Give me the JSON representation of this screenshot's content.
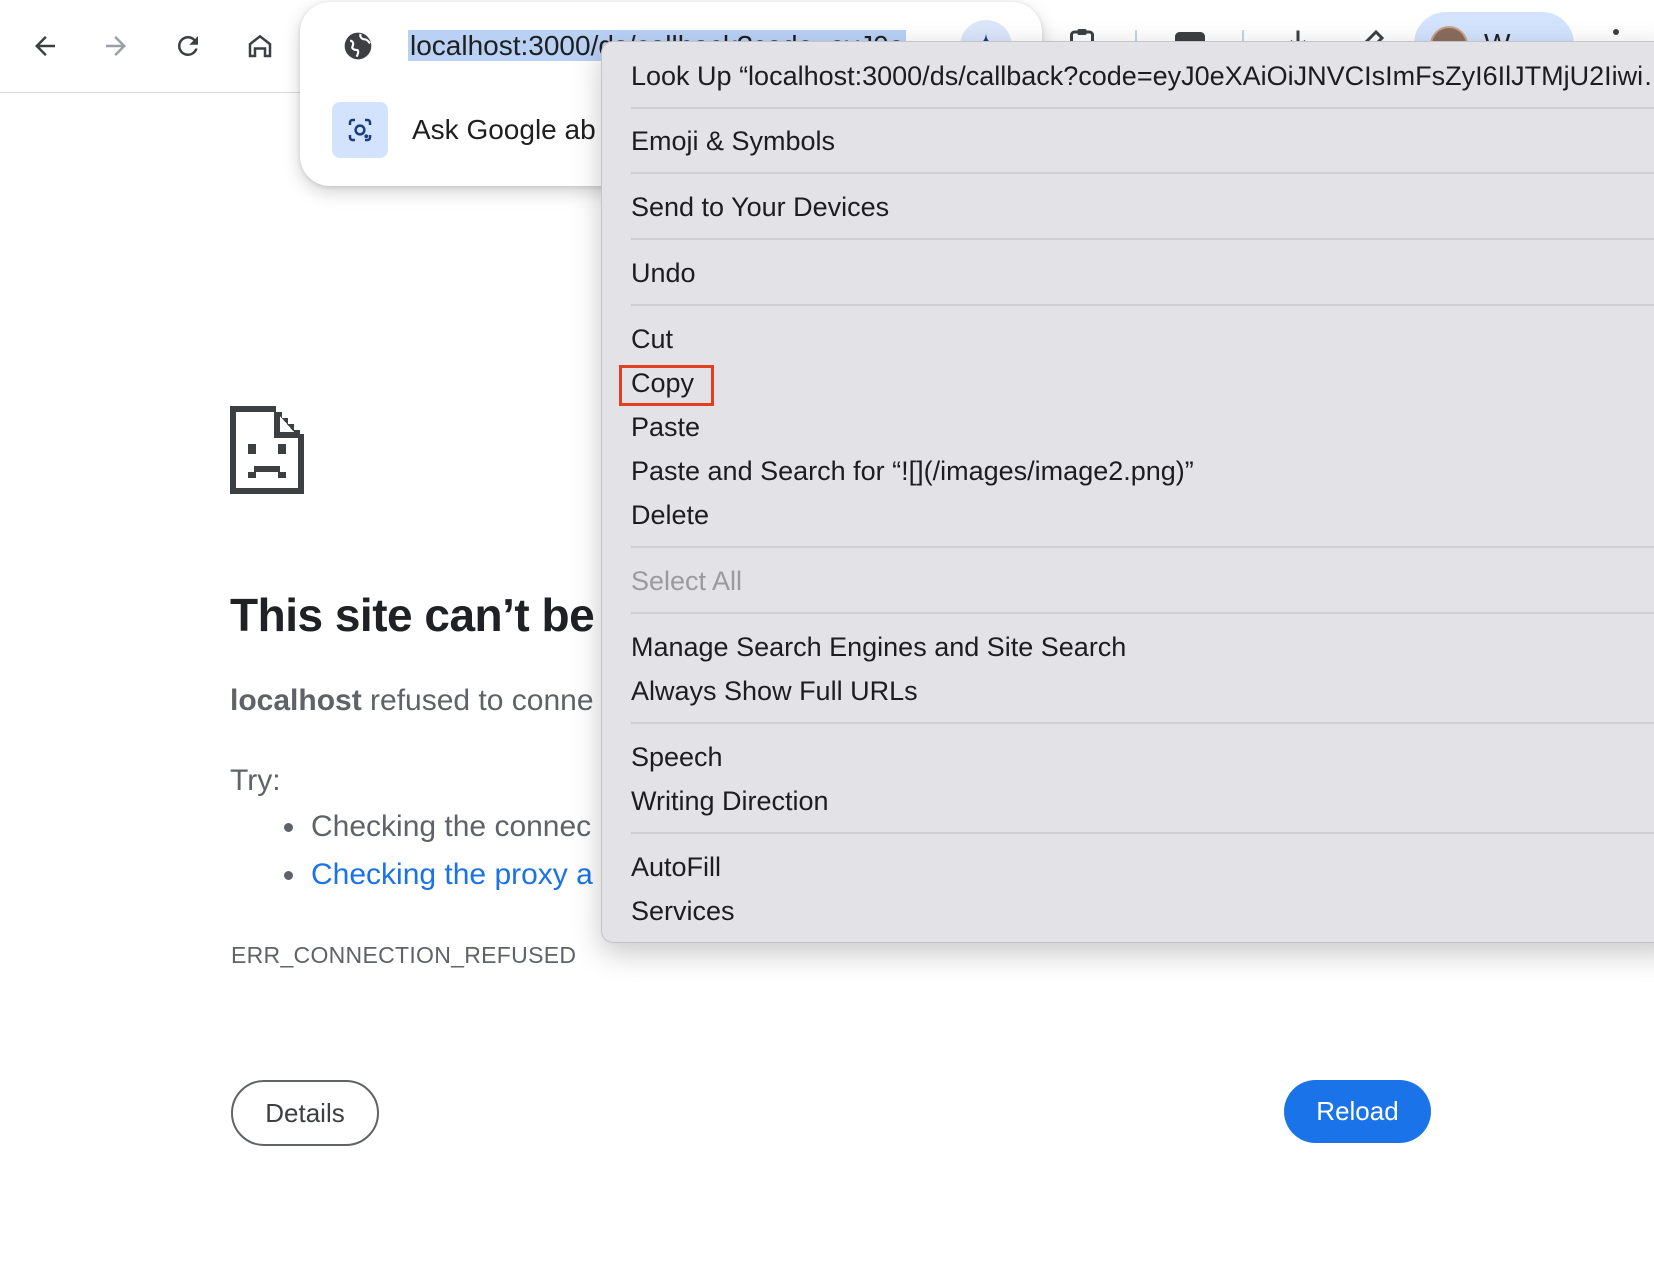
{
  "toolbar": {
    "back_icon": "arrow-left-icon",
    "forward_icon": "arrow-right-icon",
    "reload_icon": "reload-icon",
    "home_icon": "home-icon",
    "profile_name": "W...",
    "right_icons": [
      "clipboard-icon",
      "sidebar-icon",
      "download-icon",
      "pen-icon"
    ]
  },
  "omnibox": {
    "url": "localhost:3000/ds/callback?code=eyJ0e",
    "suggestion": "Ask Google ab",
    "site_icon": "globe-icon",
    "spark_icon": "sparkle-icon",
    "lens_icon": "google-lens-icon",
    "selection_color": "#b9d1f5"
  },
  "error_page": {
    "title": "This site can’t be r",
    "host": "localhost",
    "description_rest": " refused to conne",
    "try_label": "Try:",
    "suggestions": [
      "Checking the connec",
      "Checking the proxy a"
    ],
    "error_code": "ERR_CONNECTION_REFUSED",
    "details_label": "Details",
    "reload_label": "Reload",
    "link_color": "#1a73e8"
  },
  "context_menu": {
    "items": [
      {
        "label": "Look Up “localhost:3000/ds/callback?code=eyJ0eXAiOiJNVCIsImFsZyI6IlJTMjU2Iiwi…",
        "enabled": true
      },
      {
        "label": "Emoji & Symbols",
        "enabled": true
      },
      {
        "label": "Send to Your Devices",
        "enabled": true
      },
      {
        "label": "Undo",
        "enabled": true
      },
      {
        "label": "Cut",
        "enabled": true
      },
      {
        "label": "Copy",
        "enabled": true,
        "highlighted": true
      },
      {
        "label": "Paste",
        "enabled": true
      },
      {
        "label": "Paste and Search for “![](/images/image2.png)”",
        "enabled": true
      },
      {
        "label": "Delete",
        "enabled": true
      },
      {
        "label": "Select All",
        "enabled": false
      },
      {
        "label": "Manage Search Engines and Site Search",
        "enabled": true
      },
      {
        "label": "Always Show Full URLs",
        "enabled": true
      },
      {
        "label": "Speech",
        "enabled": true
      },
      {
        "label": "Writing Direction",
        "enabled": true
      },
      {
        "label": "AutoFill",
        "enabled": true
      },
      {
        "label": "Services",
        "enabled": true
      }
    ],
    "highlight_color": "#e0401f"
  }
}
